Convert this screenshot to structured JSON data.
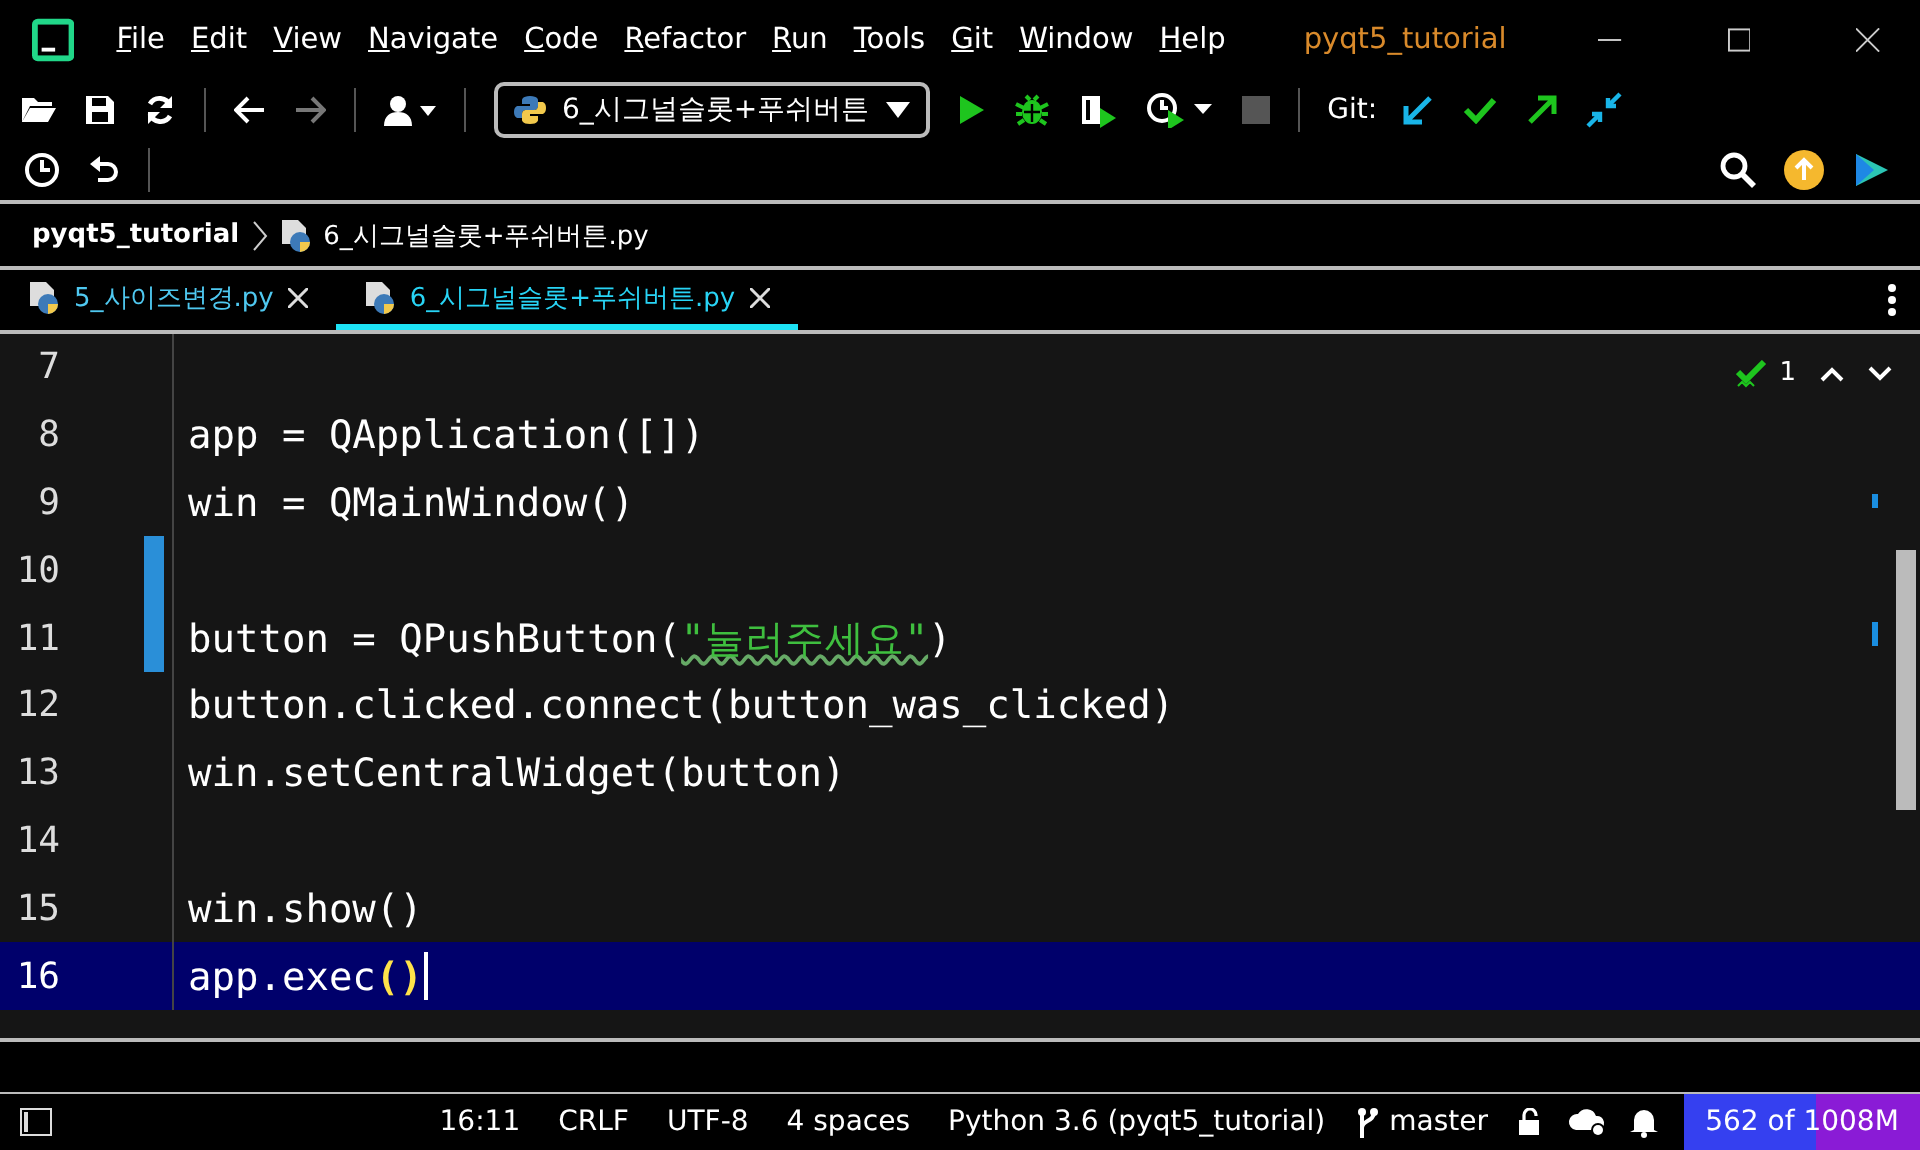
{
  "window": {
    "title": "pyqt5_tutorial"
  },
  "menu": [
    "File",
    "Edit",
    "View",
    "Navigate",
    "Code",
    "Refactor",
    "Run",
    "Tools",
    "Git",
    "Window",
    "Help"
  ],
  "run_config": {
    "label": "6_시그널슬롯+푸쉬버튼"
  },
  "git_label": "Git:",
  "breadcrumb": [
    "pyqt5_tutorial",
    "6_시그널슬롯+푸쉬버튼.py"
  ],
  "tabs": [
    {
      "label": "5_사이즈변경.py",
      "selected": false
    },
    {
      "label": "6_시그널슬롯+푸쉬버튼.py",
      "selected": true
    }
  ],
  "inspection": {
    "count": "1"
  },
  "lines": [
    {
      "number": "7",
      "current": false,
      "changed": false
    },
    {
      "number": "8",
      "current": false,
      "changed": false,
      "tokens": [
        {
          "kind": "plain",
          "text": "app = QApplication([])"
        }
      ]
    },
    {
      "number": "9",
      "current": false,
      "changed": false,
      "tokens": [
        {
          "kind": "plain",
          "text": "win = QMainWindow()"
        }
      ]
    },
    {
      "number": "10",
      "current": false,
      "changed": true
    },
    {
      "number": "11",
      "current": false,
      "changed": true,
      "tokens": [
        {
          "kind": "plain",
          "text": "button = QPushButton("
        },
        {
          "kind": "string",
          "text": "\"눌러주세요\""
        },
        {
          "kind": "plain",
          "text": ")"
        }
      ]
    },
    {
      "number": "12",
      "current": false,
      "changed": false,
      "tokens": [
        {
          "kind": "plain",
          "text": "button.clicked.connect(button_was_clicked)"
        }
      ]
    },
    {
      "number": "13",
      "current": false,
      "changed": false,
      "tokens": [
        {
          "kind": "plain",
          "text": "win.setCentralWidget(button)"
        }
      ]
    },
    {
      "number": "14",
      "current": false,
      "changed": false
    },
    {
      "number": "15",
      "current": false,
      "changed": false,
      "tokens": [
        {
          "kind": "plain",
          "text": "win.show()"
        }
      ]
    },
    {
      "number": "16",
      "current": true,
      "changed": false,
      "tokens": [
        {
          "kind": "plain",
          "text": "app.exec"
        },
        {
          "kind": "match",
          "text": "()"
        }
      ]
    }
  ],
  "status": {
    "position": "16:11",
    "line_ending": "CRLF",
    "encoding": "UTF-8",
    "indent": "4 spaces",
    "interpreter": "Python 3.6 (pyqt5_tutorial)",
    "branch": "master",
    "memory": {
      "text": "562 of 1008M",
      "level": 0.56
    }
  }
}
